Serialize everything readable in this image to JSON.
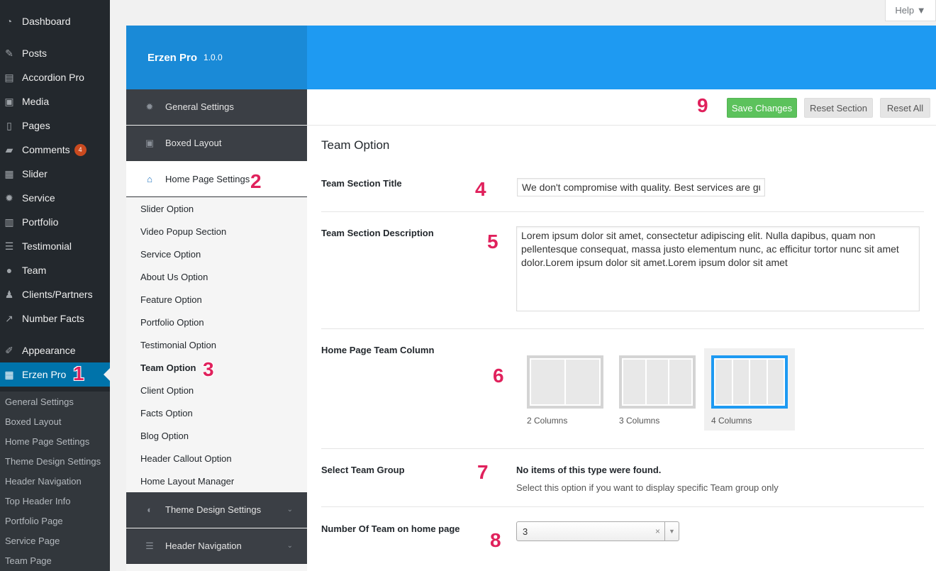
{
  "help": {
    "label": "Help ▼"
  },
  "wp_menu": {
    "items": [
      {
        "label": "Dashboard",
        "icon": "dashboard-icon"
      },
      {
        "label": "Posts",
        "icon": "pin-icon"
      },
      {
        "label": "Accordion Pro",
        "icon": "accordion-icon"
      },
      {
        "label": "Media",
        "icon": "media-icon"
      },
      {
        "label": "Pages",
        "icon": "pages-icon"
      },
      {
        "label": "Comments",
        "icon": "comment-icon",
        "badge": "4"
      },
      {
        "label": "Slider",
        "icon": "slider-icon"
      },
      {
        "label": "Service",
        "icon": "gear-icon"
      },
      {
        "label": "Portfolio",
        "icon": "portfolio-icon"
      },
      {
        "label": "Testimonial",
        "icon": "list-icon"
      },
      {
        "label": "Team",
        "icon": "team-icon"
      },
      {
        "label": "Clients/Partners",
        "icon": "person-icon"
      },
      {
        "label": "Number Facts",
        "icon": "chart-icon"
      },
      {
        "label": "Appearance",
        "icon": "brush-icon"
      },
      {
        "label": "Erzen Pro",
        "icon": "table-icon"
      }
    ],
    "submenu": [
      "General Settings",
      "Boxed Layout",
      "Home Page Settings",
      "Theme Design Settings",
      "Header Navigation",
      "Top Header Info",
      "Portfolio Page",
      "Service Page",
      "Team Page"
    ]
  },
  "brand": {
    "name": "Erzen Pro",
    "version": "1.0.0"
  },
  "options_menu": {
    "general": "General Settings",
    "boxed": "Boxed Layout",
    "home": "Home Page Settings",
    "home_sub": [
      "Slider Option",
      "Video Popup Section",
      "Service Option",
      "About Us Option",
      "Feature Option",
      "Portfolio Option",
      "Testimonial Option",
      "Team Option",
      "Client Option",
      "Facts Option",
      "Blog Option",
      "Header Callout Option",
      "Home Layout Manager"
    ],
    "theme_design": "Theme Design Settings",
    "header_nav": "Header Navigation"
  },
  "toolbar": {
    "save": "Save Changes",
    "reset_section": "Reset Section",
    "reset_all": "Reset All"
  },
  "content": {
    "title": "Team Option",
    "fields": {
      "title_label": "Team Section Title",
      "title_value": "We don't compromise with quality. Best services are guaranteed",
      "desc_label": "Team Section Description",
      "desc_value": "Lorem ipsum dolor sit amet, consectetur adipiscing elit. Nulla dapibus, quam non pellentesque consequat, massa justo elementum nunc, ac efficitur tortor nunc sit amet dolor.Lorem ipsum dolor sit amet.Lorem ipsum dolor sit amet",
      "column_label": "Home Page Team Column",
      "columns": [
        "2 Columns",
        "3 Columns",
        "4 Columns"
      ],
      "selected_column": "4 Columns",
      "group_label": "Select Team Group",
      "group_msg": "No items of this type were found.",
      "group_help": "Select this option if you want to display specific Team group only",
      "number_label": "Number Of Team on home page",
      "number_value": "3",
      "clear_symbol": "×",
      "arrow_symbol": "▼"
    }
  },
  "annotations": [
    "1",
    "2",
    "3",
    "4",
    "5",
    "6",
    "7",
    "8",
    "9"
  ],
  "colors": {
    "accent": "#1e9af2",
    "save": "#5cc25c",
    "wp_active": "#0073aa",
    "annotation": "#e0215c"
  }
}
